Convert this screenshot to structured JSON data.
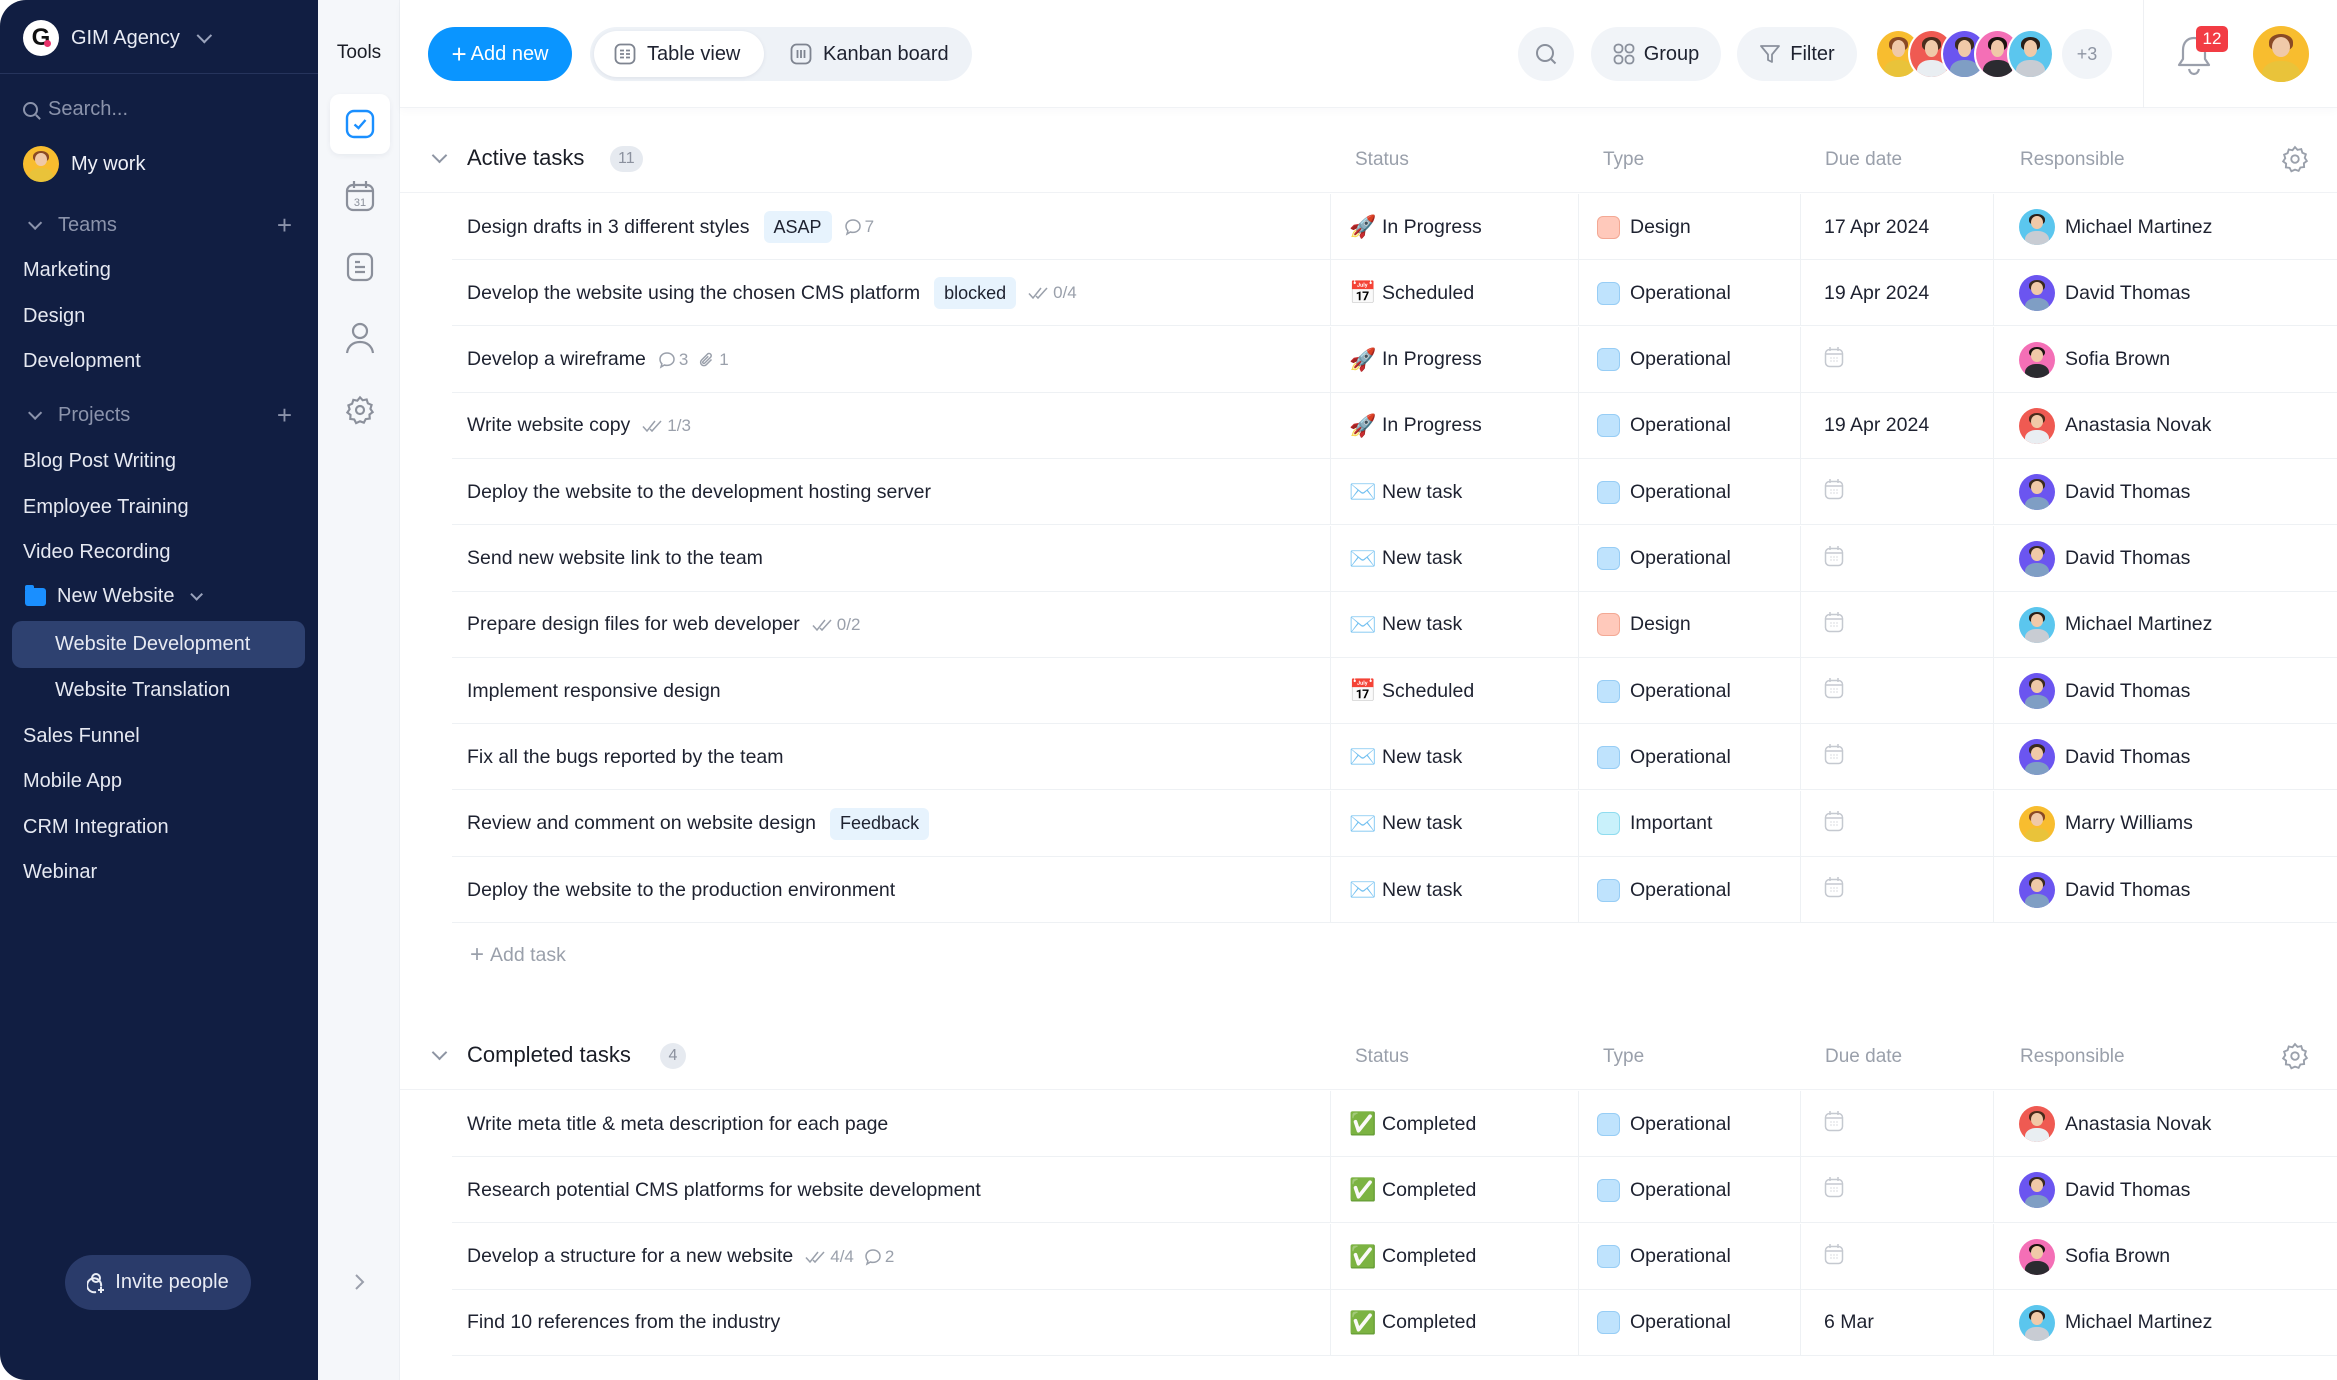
{
  "sidebar": {
    "workspace": "GIM Agency",
    "logo_letter": "G",
    "search_placeholder": "Search...",
    "my_work": "My work",
    "teams_label": "Teams",
    "teams": [
      "Marketing",
      "Design",
      "Development"
    ],
    "projects_label": "Projects",
    "projects_top": [
      "Blog Post Writing",
      "Employee Training",
      "Video Recording"
    ],
    "folder": "New Website",
    "folder_children": [
      "Website Development",
      "Website Translation"
    ],
    "active_project": "Website Development",
    "projects_bottom": [
      "Sales Funnel",
      "Mobile App",
      "CRM Integration",
      "Webinar"
    ],
    "invite_label": "Invite people"
  },
  "tools": {
    "title": "Tools",
    "items": [
      "tasks",
      "calendar",
      "docs",
      "people",
      "settings"
    ],
    "calendar_day": "31"
  },
  "topbar": {
    "add_new": "Add new",
    "views": [
      "Table view",
      "Kanban board"
    ],
    "active_view": "Table view",
    "group": "Group",
    "filter": "Filter",
    "more_members": "+3",
    "notifications": "12"
  },
  "colors": {
    "sidebar_bg": "#111e42",
    "accent": "#0a95ff",
    "badge": "#f23c44"
  },
  "columns": [
    "Status",
    "Type",
    "Due date",
    "Responsible"
  ],
  "sections": [
    {
      "title": "Active tasks",
      "count": "11",
      "add_task": "Add task",
      "tasks": [
        {
          "title": "Design drafts in 3 different styles",
          "tag": "ASAP",
          "comments": "7",
          "status": "In Progress",
          "type": "Design",
          "due": "17 Apr 2024",
          "responsible": "Michael Martinez"
        },
        {
          "title": "Develop the website using the chosen CMS platform",
          "tag": "blocked",
          "subtasks": "0/4",
          "status": "Scheduled",
          "type": "Operational",
          "due": "19 Apr 2024",
          "responsible": "David Thomas"
        },
        {
          "title": "Develop a wireframe",
          "comments": "3",
          "attachments": "1",
          "status": "In Progress",
          "type": "Operational",
          "due": "",
          "responsible": "Sofia Brown"
        },
        {
          "title": "Write website copy",
          "subtasks": "1/3",
          "status": "In Progress",
          "type": "Operational",
          "due": "19 Apr 2024",
          "responsible": "Anastasia Novak"
        },
        {
          "title": "Deploy the website to the development hosting server",
          "status": "New task",
          "type": "Operational",
          "due": "",
          "responsible": "David Thomas"
        },
        {
          "title": "Send new website link to the team",
          "status": "New task",
          "type": "Operational",
          "due": "",
          "responsible": "David Thomas"
        },
        {
          "title": "Prepare design files for web developer",
          "subtasks": "0/2",
          "status": "New task",
          "type": "Design",
          "due": "",
          "responsible": "Michael Martinez"
        },
        {
          "title": "Implement responsive design",
          "status": "Scheduled",
          "type": "Operational",
          "due": "",
          "responsible": "David Thomas"
        },
        {
          "title": "Fix all the bugs reported by the team",
          "status": "New task",
          "type": "Operational",
          "due": "",
          "responsible": "David Thomas"
        },
        {
          "title": "Review and comment on website design",
          "tag": "Feedback",
          "status": "New task",
          "type": "Important",
          "due": "",
          "responsible": "Marry Williams"
        },
        {
          "title": "Deploy the website to the production environment",
          "status": "New task",
          "type": "Operational",
          "due": "",
          "responsible": "David Thomas"
        }
      ]
    },
    {
      "title": "Completed tasks",
      "count": "4",
      "tasks": [
        {
          "title": "Write meta title & meta description for each page",
          "status": "Completed",
          "type": "Operational",
          "due": "",
          "responsible": "Anastasia Novak"
        },
        {
          "title": "Research potential CMS platforms for website development",
          "status": "Completed",
          "type": "Operational",
          "due": "",
          "responsible": "David Thomas"
        },
        {
          "title": "Develop a structure for a new website",
          "subtasks": "4/4",
          "comments": "2",
          "status": "Completed",
          "type": "Operational",
          "due": "",
          "responsible": "Sofia Brown"
        },
        {
          "title": "Find 10 references from the industry",
          "status": "Completed",
          "type": "Operational",
          "due": "6 Mar",
          "responsible": "Michael Martinez"
        }
      ]
    }
  ],
  "status_icons": {
    "In Progress": "🚀",
    "Scheduled": "📅",
    "New task": "✉️",
    "Completed": "✅"
  },
  "type_colors": {
    "Design": {
      "fill": "#ffc9bb",
      "border": "#f3a894"
    },
    "Operational": {
      "fill": "#bfe3fd",
      "border": "#97cdf5"
    },
    "Important": {
      "fill": "#c9f1fb",
      "border": "#8fdcef"
    }
  },
  "people": {
    "Michael Martinez": {
      "bg": "#5bc6ee",
      "shirt": "#c8ccd3",
      "hair": "#2a1f18"
    },
    "David Thomas": {
      "bg": "#6b55f0",
      "shirt": "#7f9ec4",
      "hair": "#3a2a1e"
    },
    "Sofia Brown": {
      "bg": "#f46fb6",
      "shirt": "#2b2b30",
      "hair": "#1c1410"
    },
    "Anastasia Novak": {
      "bg": "#ef5a52",
      "shirt": "#e9eef2",
      "hair": "#4a2c1c"
    },
    "Marry Williams": {
      "bg": "#f8bd2f",
      "shirt": "#e9c33a",
      "hair": "#8a4a25"
    }
  },
  "team_avatars": [
    "Marry Williams",
    "Anastasia Novak",
    "David Thomas",
    "Sofia Brown",
    "Michael Martinez"
  ],
  "current_user": "Marry Williams"
}
